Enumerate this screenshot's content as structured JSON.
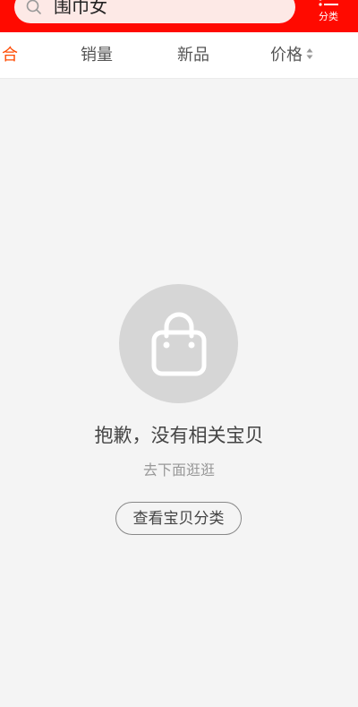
{
  "header": {
    "search_text": "围巾女",
    "category_label": "分类",
    "background_color": "#ff0a00",
    "search_icon": "search-icon",
    "category_icon": "list-menu-icon"
  },
  "tabs": [
    {
      "label": "综合",
      "visible_label": "合",
      "active": true
    },
    {
      "label": "销量",
      "active": false
    },
    {
      "label": "新品",
      "active": false
    },
    {
      "label": "价格",
      "active": false,
      "icon": "sort-updown-icon"
    }
  ],
  "accent_color": "#ff4a00",
  "empty_state": {
    "icon": "shopping-bag-icon",
    "title": "抱歉，没有相关宝贝",
    "subtitle": "去下面逛逛",
    "button_label": "查看宝贝分类"
  }
}
